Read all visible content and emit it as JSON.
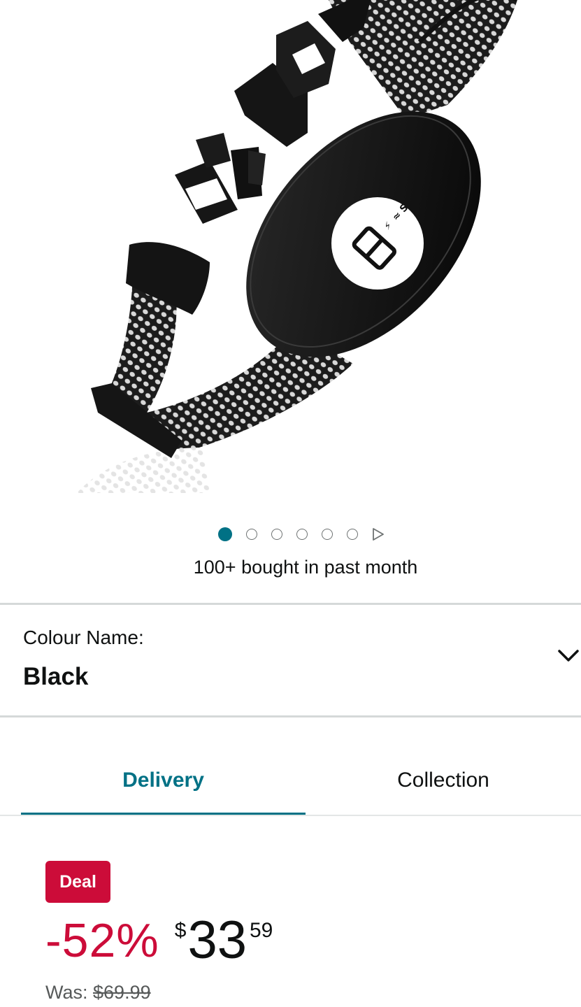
{
  "product_image": {
    "alt": "Black mesh dog collar with digital display unit"
  },
  "carousel": {
    "total_dots": 6,
    "active_index": 0
  },
  "social_proof": "100+ bought in past month",
  "variation": {
    "label": "Colour Name:",
    "value": "Black"
  },
  "fulfilment_tabs": {
    "delivery": "Delivery",
    "collection": "Collection",
    "selected": "delivery"
  },
  "pricing": {
    "badge": "Deal",
    "discount": "-52%",
    "currency_symbol": "$",
    "whole": "33",
    "fraction": "59",
    "was_label": "Was:",
    "was_price": "$69.99"
  },
  "colors": {
    "accent": "#007185",
    "deal": "#cc0c39",
    "text": "#0f1111",
    "muted": "#565959"
  }
}
